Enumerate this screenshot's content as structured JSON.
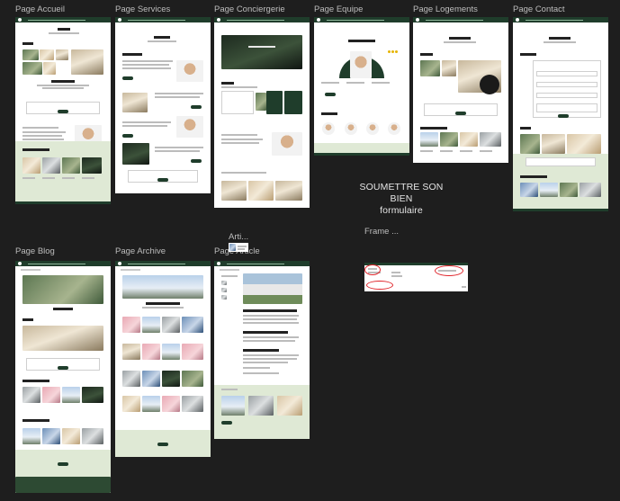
{
  "frames": {
    "accueil": {
      "label": "Page Accueil"
    },
    "services": {
      "label": "Page Services"
    },
    "conciergerie": {
      "label": "Page Conciergerie"
    },
    "equipe": {
      "label": "Page Equipe"
    },
    "logements": {
      "label": "Page Logements"
    },
    "contact": {
      "label": "Page Contact"
    },
    "blog": {
      "label": "Page Blog"
    },
    "archive": {
      "label": "Page Archive"
    },
    "article": {
      "label": "Page Article"
    }
  },
  "floating": {
    "arti_label": "Arti...",
    "frame_label": "Frame ...",
    "note_line1": "SOUMETTRE SON BIEN",
    "note_line2": "formulaire"
  },
  "colors": {
    "canvas": "#1e1e1e",
    "brand_green": "#1f3d2b",
    "footer_green": "#dfe9d5",
    "annotation_red": "#e0242a"
  }
}
